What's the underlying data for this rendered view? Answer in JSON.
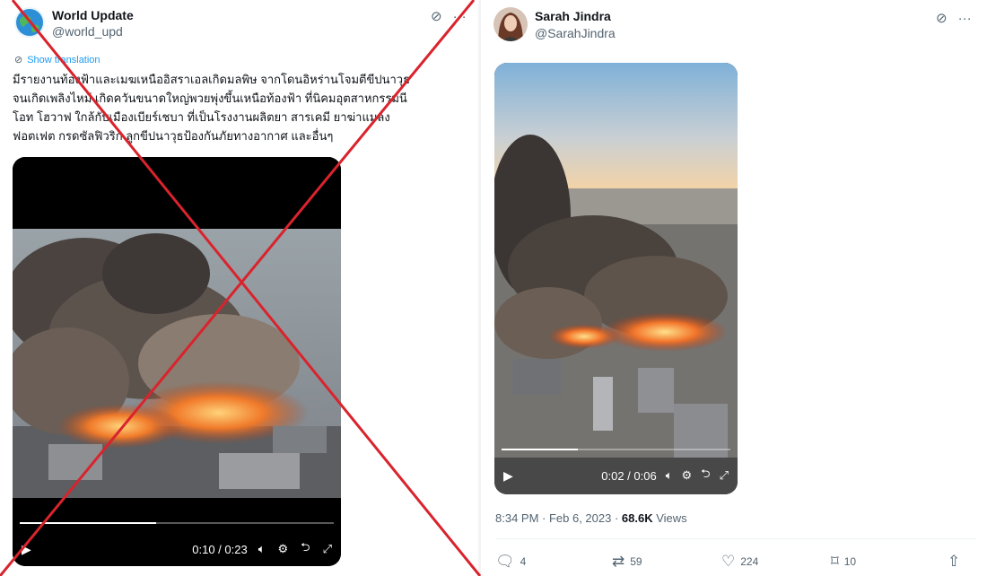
{
  "left_post": {
    "author_name": "World Update",
    "author_handle": "@world_upd",
    "grok_icon": "grok-slash-icon",
    "more_icon": "more-dots-icon",
    "show_translation": "Show translation",
    "text_lines": [
      "มีรายงานท้องฟ้าและเมฆเหนืออิสราเอลเกิดมลพิษ จากโดนอิหร่านโจมตีขีปนาวุธ",
      "จนเกิดเพลิงไหม้ เกิดควันขนาดใหญ่พวยพุ่งขึ้นเหนือท้องฟ้า ที่นิคมอุตสาหกรรมนี",
      "โอท โฮวาฟ ใกล้กับเมืองเบียร์เชบา ที่เป็นโรงงานผลิตยา สารเคมี ยาฆ่าแมลง",
      "ฟอตเฟต กรดซัลฟิวริก ลูกขีปนาวุธป้องกันภัยทางอากาศ และอื่นๆ"
    ],
    "video": {
      "time": "0:10 / 0:23",
      "progress": 0.434
    }
  },
  "right_post": {
    "author_name": "Sarah Jindra",
    "author_handle": "@SarahJindra",
    "video": {
      "time": "0:02 / 0:06",
      "progress": 0.333
    },
    "timestamp": "8:34 PM · Feb 6, 2023 · ",
    "views_count": "68.6K",
    "views_label": " Views",
    "stats": {
      "replies": "4",
      "reposts": "59",
      "likes": "224",
      "bookmarks": "10"
    }
  },
  "overlay": {
    "cross_color": "#d9232d",
    "meaning": "false-claim-cross"
  },
  "colors": {
    "accent": "#1d9bf0",
    "secondary_text": "#536471"
  }
}
